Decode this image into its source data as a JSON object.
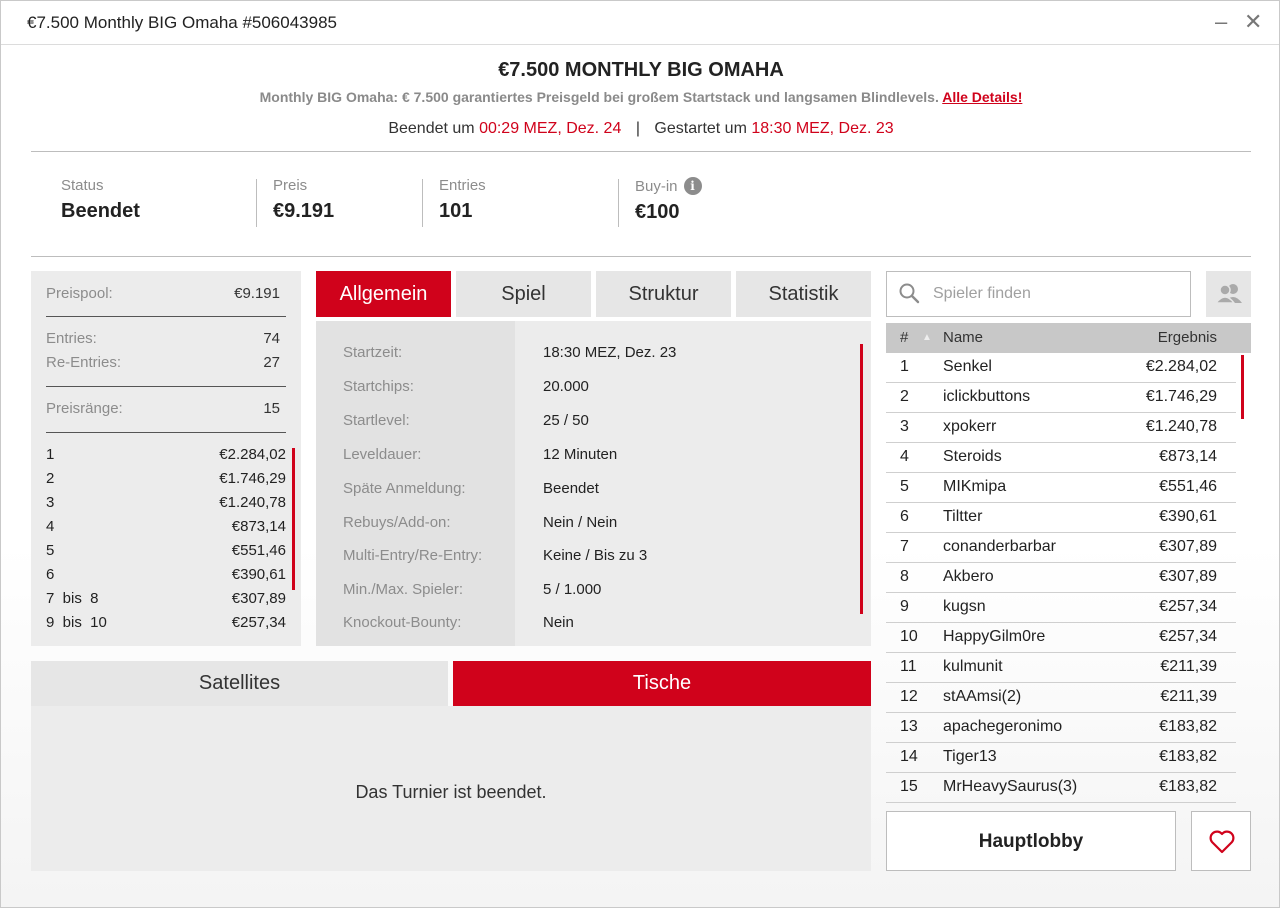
{
  "window": {
    "title": "€7.500 Monthly BIG Omaha #506043985",
    "minimize": "–",
    "close": "✕"
  },
  "header": {
    "title": "€7.500 MONTHLY BIG OMAHA",
    "subtitle": "Monthly BIG Omaha: € 7.500 garantiertes Preisgeld bei großem Startstack und langsamen Blindlevels.",
    "details_link": "Alle Details!",
    "ended_label": "Beendet um",
    "ended_value": "00:29 MEZ, Dez. 24",
    "separator": "|",
    "started_label": "Gestartet um",
    "started_value": "18:30 MEZ, Dez. 23"
  },
  "stats": {
    "status_label": "Status",
    "status_value": "Beendet",
    "prize_label": "Preis",
    "prize_value": "€9.191",
    "entries_label": "Entries",
    "entries_value": "101",
    "buyin_label": "Buy-in",
    "buyin_value": "€100",
    "info_glyph": "i"
  },
  "prize_panel": {
    "pool_label": "Preispool:",
    "pool_value": "€9.191",
    "entries_label": "Entries:",
    "entries_value": "74",
    "reentries_label": "Re-Entries:",
    "reentries_value": "27",
    "ranks_label": "Preisränge:",
    "ranks_value": "15",
    "places": [
      {
        "place": "1",
        "amount": "€2.284,02"
      },
      {
        "place": "2",
        "amount": "€1.746,29"
      },
      {
        "place": "3",
        "amount": "€1.240,78"
      },
      {
        "place": "4",
        "amount": "€873,14"
      },
      {
        "place": "5",
        "amount": "€551,46"
      },
      {
        "place": "6",
        "amount": "€390,61"
      },
      {
        "place": "7  bis  8",
        "amount": "€307,89"
      },
      {
        "place": "9  bis  10",
        "amount": "€257,34"
      }
    ]
  },
  "tabs": [
    "Allgemein",
    "Spiel",
    "Struktur",
    "Statistik"
  ],
  "details": [
    {
      "key": "Startzeit:",
      "value": "18:30 MEZ, Dez. 23"
    },
    {
      "key": "Startchips:",
      "value": "20.000"
    },
    {
      "key": "Startlevel:",
      "value": "25 / 50"
    },
    {
      "key": "Leveldauer:",
      "value": "12 Minuten"
    },
    {
      "key": "Späte Anmeldung:",
      "value": "Beendet"
    },
    {
      "key": "Rebuys/Add-on:",
      "value": "Nein / Nein"
    },
    {
      "key": "Multi-Entry/Re-Entry:",
      "value": "Keine / Bis zu 3"
    },
    {
      "key": "Min./Max. Spieler:",
      "value": "5 / 1.000"
    },
    {
      "key": "Knockout-Bounty:",
      "value": "Nein"
    }
  ],
  "bottom_tabs": [
    "Satellites",
    "Tische"
  ],
  "bottom_message": "Das Turnier ist beendet.",
  "search": {
    "placeholder": "Spieler finden"
  },
  "players_table": {
    "col_rank": "#",
    "sort_glyph": "▲",
    "col_name": "Name",
    "col_result": "Ergebnis",
    "rows": [
      {
        "rank": "1",
        "name": "Senkel",
        "result": "€2.284,02"
      },
      {
        "rank": "2",
        "name": "iclickbuttons",
        "result": "€1.746,29"
      },
      {
        "rank": "3",
        "name": "xpokerr",
        "result": "€1.240,78"
      },
      {
        "rank": "4",
        "name": "Steroids",
        "result": "€873,14"
      },
      {
        "rank": "5",
        "name": "MIKmipa",
        "result": "€551,46"
      },
      {
        "rank": "6",
        "name": "Tiltter",
        "result": "€390,61"
      },
      {
        "rank": "7",
        "name": "conanderbarbar",
        "result": "€307,89"
      },
      {
        "rank": "8",
        "name": "Akbero",
        "result": "€307,89"
      },
      {
        "rank": "9",
        "name": "kugsn",
        "result": "€257,34"
      },
      {
        "rank": "10",
        "name": "HappyGilm0re",
        "result": "€257,34"
      },
      {
        "rank": "11",
        "name": "kulmunit",
        "result": "€211,39"
      },
      {
        "rank": "12",
        "name": "stAAmsi(2)",
        "result": "€211,39"
      },
      {
        "rank": "13",
        "name": "apachegeronimo",
        "result": "€183,82"
      },
      {
        "rank": "14",
        "name": "Tiger13",
        "result": "€183,82"
      },
      {
        "rank": "15",
        "name": "MrHeavySaurus(3)",
        "result": "€183,82"
      }
    ]
  },
  "buttons": {
    "main_lobby": "Hauptlobby"
  },
  "colors": {
    "accent": "#d0021b",
    "panel": "#ececec",
    "tab_inactive": "#e6e6e6"
  }
}
